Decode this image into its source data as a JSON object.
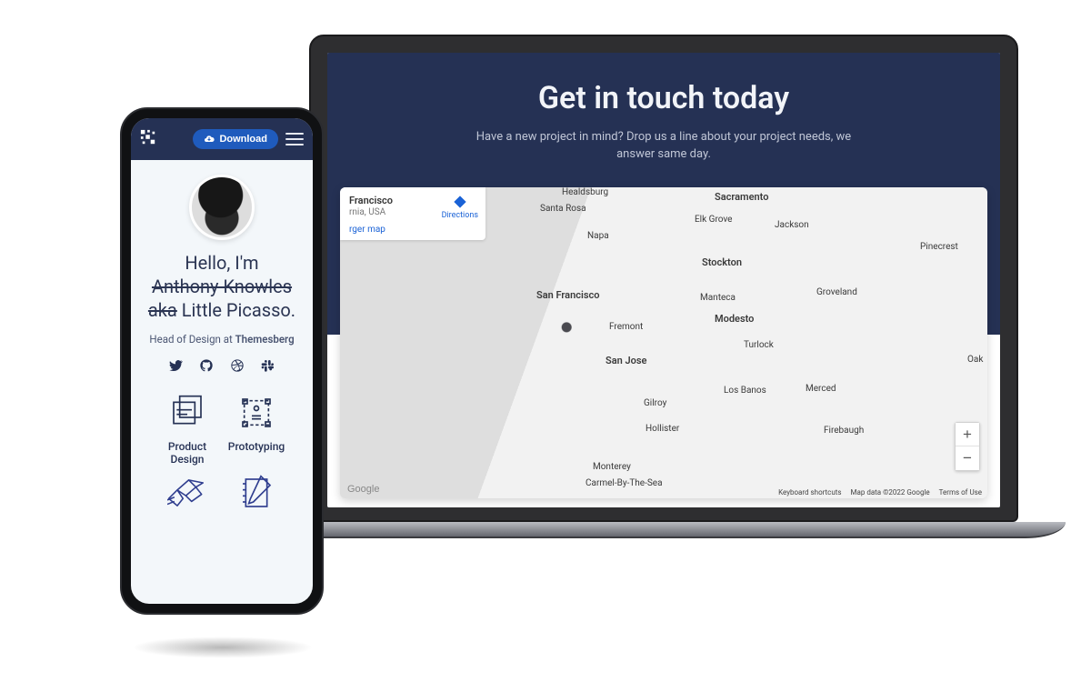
{
  "laptop": {
    "hero_title": "Get in touch today",
    "hero_sub": "Have a new project in mind? Drop us a line about your project needs, we answer same day.",
    "map": {
      "info_title": "Francisco",
      "info_sub": "rnia, USA",
      "info_link": "rger map",
      "directions_label": "Directions",
      "google": "Google",
      "labels": {
        "santa_rosa": "Santa Rosa",
        "healdsburg": "Healdsburg",
        "napa": "Napa",
        "san_francisco": "San Francisco",
        "fremont": "Fremont",
        "san_jose": "San Jose",
        "gilroy": "Gilroy",
        "hollister": "Hollister",
        "monterey": "Monterey",
        "carmel": "Carmel-By-The-Sea",
        "sacramento": "Sacramento",
        "elk_grove": "Elk Grove",
        "stockton": "Stockton",
        "modesto": "Modesto",
        "manteca": "Manteca",
        "los_banos": "Los Banos",
        "jackson": "Jackson",
        "groveland": "Groveland",
        "turlock": "Turlock",
        "merced": "Merced",
        "firebaugh": "Firebaugh",
        "pinecrest": "Pinecrest",
        "oak": "Oak"
      },
      "zoom_in": "+",
      "zoom_out": "−",
      "attrib": {
        "shortcuts": "Keyboard shortcuts",
        "copyright": "Map data ©2022 Google",
        "terms": "Terms of Use"
      }
    }
  },
  "phone": {
    "download_label": "Download",
    "hello": "Hello, I'm",
    "name_strike": "Anthony Knowles",
    "aka_strike": "aka",
    "nick": " Little Picasso.",
    "role_prefix": "Head of Design at ",
    "role_company": "Themesberg",
    "services": {
      "s1": "Product Design",
      "s2": "Prototyping"
    }
  }
}
